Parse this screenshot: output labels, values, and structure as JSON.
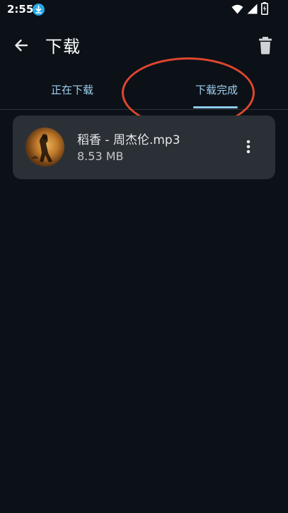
{
  "status_bar": {
    "time": "2:55",
    "icons": [
      "download-notification-icon",
      "wifi-icon",
      "signal-icon",
      "battery-icon"
    ]
  },
  "app_bar": {
    "title": "下载",
    "back_icon": "arrow-left-icon",
    "delete_icon": "trash-icon"
  },
  "tabs": [
    {
      "label": "正在下载",
      "selected": false
    },
    {
      "label": "下载完成",
      "selected": true
    }
  ],
  "downloads": [
    {
      "title": "稻香 - 周杰伦.mp3",
      "size": "8.53 MB",
      "menu_icon": "more-vert-icon"
    }
  ],
  "colors": {
    "background": "#0b1117",
    "accent": "#8fcaf0",
    "card": "#2b3036",
    "annotation": "#e0452f"
  }
}
